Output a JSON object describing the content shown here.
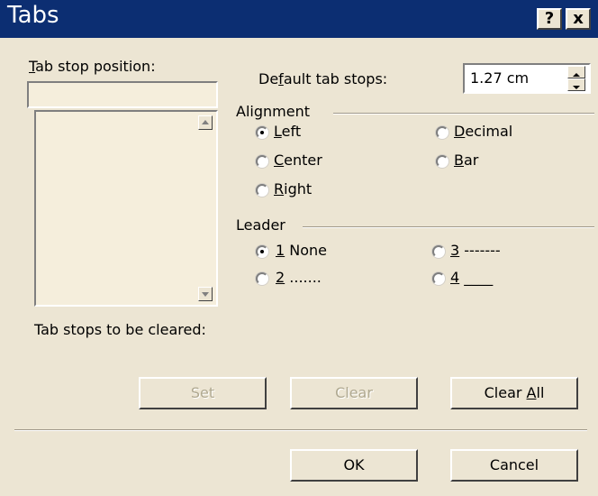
{
  "window": {
    "title": "Tabs",
    "help_glyph": "?",
    "close_glyph": "x"
  },
  "tab_stop_position": {
    "label_u": "T",
    "label_rest": "ab stop position:",
    "value": "",
    "list_items": []
  },
  "default_tab_stops": {
    "label_pre": "De",
    "label_u": "f",
    "label_rest": "ault tab stops:",
    "value": "1.27 cm"
  },
  "alignment": {
    "group_label": "Alignment",
    "options": [
      {
        "u": "L",
        "rest": "eft",
        "checked": true
      },
      {
        "u": "D",
        "rest": "ecimal",
        "checked": false
      },
      {
        "u": "C",
        "rest": "enter",
        "checked": false
      },
      {
        "u": "B",
        "rest": "ar",
        "checked": false
      },
      {
        "u": "R",
        "rest": "ight",
        "checked": false
      }
    ]
  },
  "leader": {
    "group_label": "Leader",
    "options": [
      {
        "u": "1",
        "rest": " None",
        "checked": true
      },
      {
        "u": "3",
        "rest": " -------",
        "checked": false
      },
      {
        "u": "2",
        "rest": " .......",
        "checked": false
      },
      {
        "u": "4",
        "rest": " ____",
        "checked": false
      }
    ]
  },
  "tab_stops_cleared_label": "Tab stops to be cleared:",
  "buttons": {
    "set": "Set",
    "clear": "Clear",
    "clear_all_pre": "Clear ",
    "clear_all_u": "A",
    "clear_all_rest": "ll",
    "ok": "OK",
    "cancel": "Cancel"
  },
  "colors": {
    "titlebar": "#0C2E72",
    "dialog_bg": "#ECE5D3",
    "disabled_text": "#AFA88F"
  }
}
